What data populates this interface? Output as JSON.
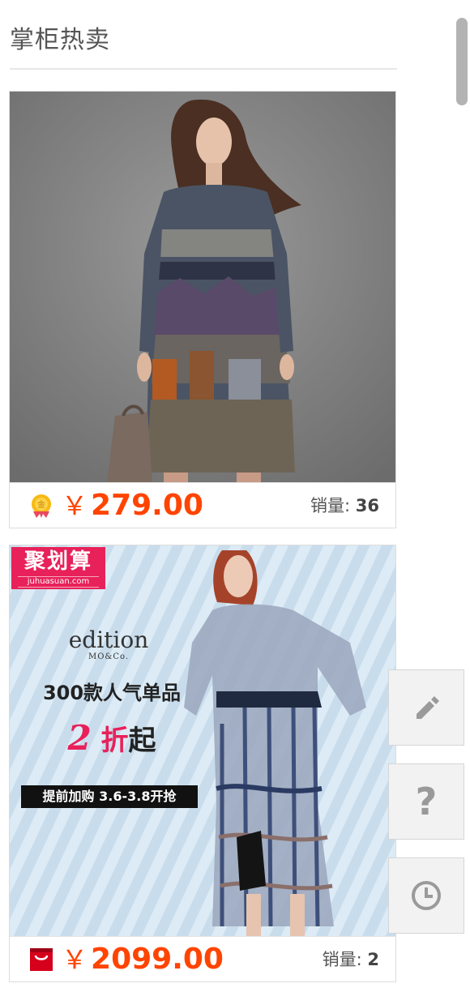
{
  "header": {
    "title": "掌柜热卖"
  },
  "products": [
    {
      "price_currency": "￥",
      "price_amount": "279.00",
      "sales_label": "销量:",
      "sales_value": "36",
      "badge_icon": "gold-coin-badge-icon"
    },
    {
      "price_currency": "￥",
      "price_amount": "2099.00",
      "sales_label": "销量:",
      "sales_value": "2",
      "badge_icon": "tmall-red-bag-icon",
      "promo": {
        "tag_title": "聚划算",
        "tag_subtitle": "juhuasuan.com",
        "brand_name": "edition",
        "brand_sub": "MO&Co.",
        "line1": "300款人气单品",
        "line2_number": "2",
        "line2_zhe": "折",
        "line2_qi": "起",
        "line3": "提前加购 3.6-3.8开抢"
      }
    }
  ],
  "floating_buttons": [
    {
      "icon": "pencil-icon"
    },
    {
      "icon": "question-mark-icon",
      "glyph": "?"
    },
    {
      "icon": "clock-icon"
    }
  ],
  "colors": {
    "price": "#ff4400",
    "promo_pink": "#e8215a",
    "divider": "#e7e7e7"
  }
}
